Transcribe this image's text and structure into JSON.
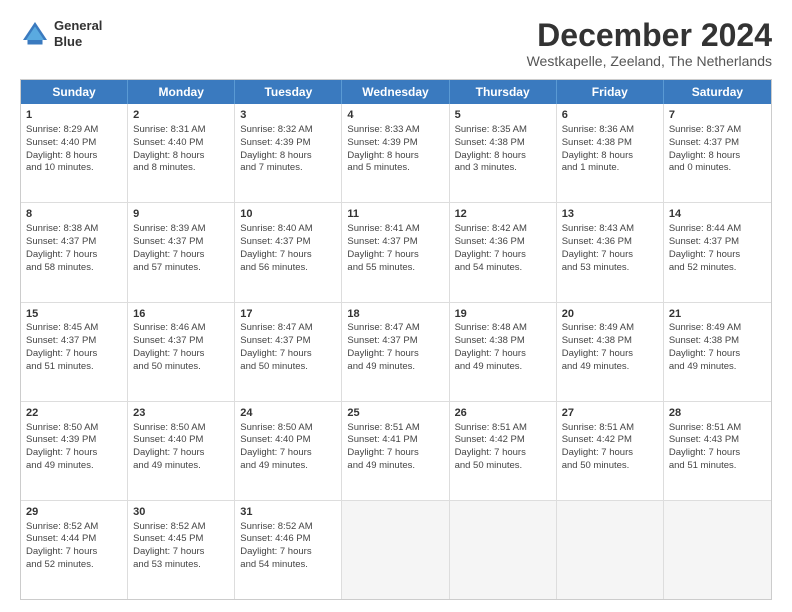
{
  "header": {
    "logo_line1": "General",
    "logo_line2": "Blue",
    "month_title": "December 2024",
    "subtitle": "Westkapelle, Zeeland, The Netherlands"
  },
  "days_of_week": [
    "Sunday",
    "Monday",
    "Tuesday",
    "Wednesday",
    "Thursday",
    "Friday",
    "Saturday"
  ],
  "weeks": [
    [
      {
        "day": "1",
        "info": "Sunrise: 8:29 AM\nSunset: 4:40 PM\nDaylight: 8 hours\nand 10 minutes."
      },
      {
        "day": "2",
        "info": "Sunrise: 8:31 AM\nSunset: 4:40 PM\nDaylight: 8 hours\nand 8 minutes."
      },
      {
        "day": "3",
        "info": "Sunrise: 8:32 AM\nSunset: 4:39 PM\nDaylight: 8 hours\nand 7 minutes."
      },
      {
        "day": "4",
        "info": "Sunrise: 8:33 AM\nSunset: 4:39 PM\nDaylight: 8 hours\nand 5 minutes."
      },
      {
        "day": "5",
        "info": "Sunrise: 8:35 AM\nSunset: 4:38 PM\nDaylight: 8 hours\nand 3 minutes."
      },
      {
        "day": "6",
        "info": "Sunrise: 8:36 AM\nSunset: 4:38 PM\nDaylight: 8 hours\nand 1 minute."
      },
      {
        "day": "7",
        "info": "Sunrise: 8:37 AM\nSunset: 4:37 PM\nDaylight: 8 hours\nand 0 minutes."
      }
    ],
    [
      {
        "day": "8",
        "info": "Sunrise: 8:38 AM\nSunset: 4:37 PM\nDaylight: 7 hours\nand 58 minutes."
      },
      {
        "day": "9",
        "info": "Sunrise: 8:39 AM\nSunset: 4:37 PM\nDaylight: 7 hours\nand 57 minutes."
      },
      {
        "day": "10",
        "info": "Sunrise: 8:40 AM\nSunset: 4:37 PM\nDaylight: 7 hours\nand 56 minutes."
      },
      {
        "day": "11",
        "info": "Sunrise: 8:41 AM\nSunset: 4:37 PM\nDaylight: 7 hours\nand 55 minutes."
      },
      {
        "day": "12",
        "info": "Sunrise: 8:42 AM\nSunset: 4:36 PM\nDaylight: 7 hours\nand 54 minutes."
      },
      {
        "day": "13",
        "info": "Sunrise: 8:43 AM\nSunset: 4:36 PM\nDaylight: 7 hours\nand 53 minutes."
      },
      {
        "day": "14",
        "info": "Sunrise: 8:44 AM\nSunset: 4:37 PM\nDaylight: 7 hours\nand 52 minutes."
      }
    ],
    [
      {
        "day": "15",
        "info": "Sunrise: 8:45 AM\nSunset: 4:37 PM\nDaylight: 7 hours\nand 51 minutes."
      },
      {
        "day": "16",
        "info": "Sunrise: 8:46 AM\nSunset: 4:37 PM\nDaylight: 7 hours\nand 50 minutes."
      },
      {
        "day": "17",
        "info": "Sunrise: 8:47 AM\nSunset: 4:37 PM\nDaylight: 7 hours\nand 50 minutes."
      },
      {
        "day": "18",
        "info": "Sunrise: 8:47 AM\nSunset: 4:37 PM\nDaylight: 7 hours\nand 49 minutes."
      },
      {
        "day": "19",
        "info": "Sunrise: 8:48 AM\nSunset: 4:38 PM\nDaylight: 7 hours\nand 49 minutes."
      },
      {
        "day": "20",
        "info": "Sunrise: 8:49 AM\nSunset: 4:38 PM\nDaylight: 7 hours\nand 49 minutes."
      },
      {
        "day": "21",
        "info": "Sunrise: 8:49 AM\nSunset: 4:38 PM\nDaylight: 7 hours\nand 49 minutes."
      }
    ],
    [
      {
        "day": "22",
        "info": "Sunrise: 8:50 AM\nSunset: 4:39 PM\nDaylight: 7 hours\nand 49 minutes."
      },
      {
        "day": "23",
        "info": "Sunrise: 8:50 AM\nSunset: 4:40 PM\nDaylight: 7 hours\nand 49 minutes."
      },
      {
        "day": "24",
        "info": "Sunrise: 8:50 AM\nSunset: 4:40 PM\nDaylight: 7 hours\nand 49 minutes."
      },
      {
        "day": "25",
        "info": "Sunrise: 8:51 AM\nSunset: 4:41 PM\nDaylight: 7 hours\nand 49 minutes."
      },
      {
        "day": "26",
        "info": "Sunrise: 8:51 AM\nSunset: 4:42 PM\nDaylight: 7 hours\nand 50 minutes."
      },
      {
        "day": "27",
        "info": "Sunrise: 8:51 AM\nSunset: 4:42 PM\nDaylight: 7 hours\nand 50 minutes."
      },
      {
        "day": "28",
        "info": "Sunrise: 8:51 AM\nSunset: 4:43 PM\nDaylight: 7 hours\nand 51 minutes."
      }
    ],
    [
      {
        "day": "29",
        "info": "Sunrise: 8:52 AM\nSunset: 4:44 PM\nDaylight: 7 hours\nand 52 minutes."
      },
      {
        "day": "30",
        "info": "Sunrise: 8:52 AM\nSunset: 4:45 PM\nDaylight: 7 hours\nand 53 minutes."
      },
      {
        "day": "31",
        "info": "Sunrise: 8:52 AM\nSunset: 4:46 PM\nDaylight: 7 hours\nand 54 minutes."
      },
      {
        "day": "",
        "info": ""
      },
      {
        "day": "",
        "info": ""
      },
      {
        "day": "",
        "info": ""
      },
      {
        "day": "",
        "info": ""
      }
    ]
  ]
}
